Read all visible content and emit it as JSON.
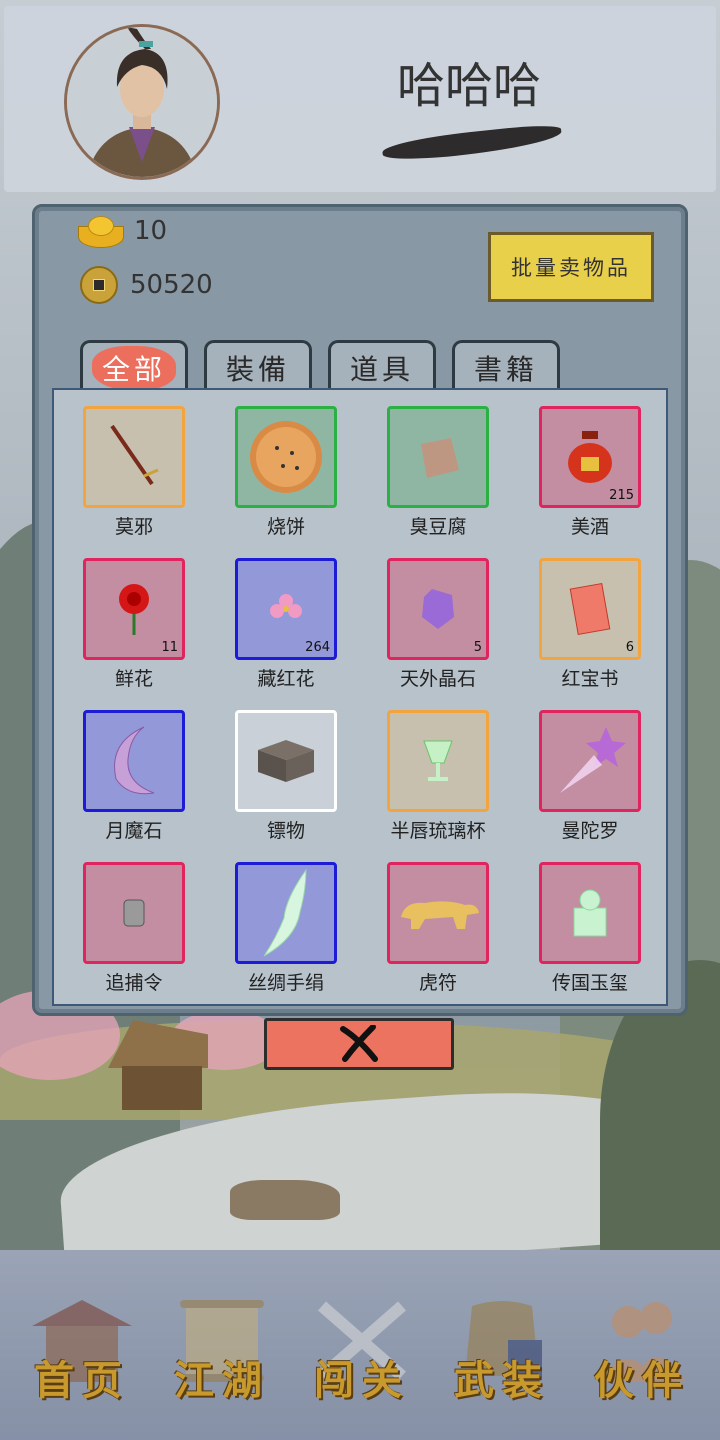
{
  "player": {
    "name": "哈哈哈"
  },
  "currency": {
    "gold_ingots": "10",
    "copper_coins": "50520"
  },
  "sell_button_label": "批量卖物品",
  "tabs": [
    {
      "label": "全部",
      "active": true
    },
    {
      "label": "裝備",
      "active": false
    },
    {
      "label": "道具",
      "active": false
    },
    {
      "label": "書籍",
      "active": false
    }
  ],
  "items": [
    {
      "name": "莫邪",
      "count": "",
      "rarity": "orange",
      "icon": "sword-icon"
    },
    {
      "name": "烧饼",
      "count": "",
      "rarity": "green",
      "icon": "flatbread-icon"
    },
    {
      "name": "臭豆腐",
      "count": "",
      "rarity": "green",
      "icon": "tofu-icon"
    },
    {
      "name": "美酒",
      "count": "215",
      "rarity": "red",
      "icon": "wine-jar-icon"
    },
    {
      "name": "鲜花",
      "count": "11",
      "rarity": "red",
      "icon": "rose-icon"
    },
    {
      "name": "藏红花",
      "count": "264",
      "rarity": "blue",
      "icon": "saffron-flower-icon"
    },
    {
      "name": "天外晶石",
      "count": "5",
      "rarity": "red",
      "icon": "crystal-icon"
    },
    {
      "name": "红宝书",
      "count": "6",
      "rarity": "orange",
      "icon": "red-book-icon"
    },
    {
      "name": "月魔石",
      "count": "",
      "rarity": "blue",
      "icon": "crescent-moon-icon"
    },
    {
      "name": "镖物",
      "count": "",
      "rarity": "white",
      "icon": "chest-icon"
    },
    {
      "name": "半唇琉璃杯",
      "count": "",
      "rarity": "orange",
      "icon": "glass-cup-icon"
    },
    {
      "name": "曼陀罗",
      "count": "",
      "rarity": "red",
      "icon": "datura-star-icon"
    },
    {
      "name": "追捕令",
      "count": "",
      "rarity": "red",
      "icon": "warrant-token-icon"
    },
    {
      "name": "丝绸手绢",
      "count": "",
      "rarity": "blue",
      "icon": "silk-handkerchief-icon"
    },
    {
      "name": "虎符",
      "count": "",
      "rarity": "red",
      "icon": "tiger-tally-icon"
    },
    {
      "name": "传国玉玺",
      "count": "",
      "rarity": "red",
      "icon": "jade-seal-icon"
    }
  ],
  "close_icon": "close-x-icon",
  "nav": [
    {
      "label": "首页",
      "icon": "house-icon"
    },
    {
      "label": "江湖",
      "icon": "scroll-icon"
    },
    {
      "label": "闯关",
      "icon": "crossed-swords-icon"
    },
    {
      "label": "武装",
      "icon": "armor-icon"
    },
    {
      "label": "伙伴",
      "icon": "partners-icon"
    }
  ],
  "colors": {
    "rarity_orange": "#f2a53e",
    "rarity_green": "#2ab043",
    "rarity_red": "#e0245e",
    "rarity_blue": "#1c1cd6",
    "rarity_white": "#ffffff",
    "accent_red": "#ec6f5d",
    "sell_button": "#e9d04b",
    "nav_gold": "#c89a2e"
  }
}
